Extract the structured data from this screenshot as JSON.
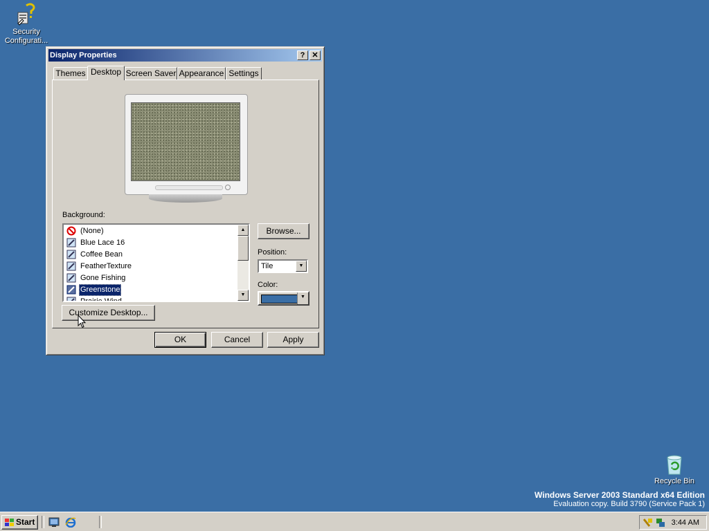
{
  "desktop": {
    "icons": [
      {
        "label": "Security Configurati...",
        "icon": "security-config-icon"
      },
      {
        "label": "Recycle Bin",
        "icon": "recycle-bin-icon"
      }
    ],
    "watermark": {
      "line1": "Windows Server 2003 Standard x64 Edition",
      "line2": "Evaluation copy. Build 3790 (Service Pack 1)"
    },
    "background_color": "#3a6ea5"
  },
  "window": {
    "title": "Display Properties",
    "help_glyph": "?",
    "close_glyph": "✕",
    "tabs": [
      {
        "label": "Themes",
        "active": false
      },
      {
        "label": "Desktop",
        "active": true
      },
      {
        "label": "Screen Saver",
        "active": false
      },
      {
        "label": "Appearance",
        "active": false
      },
      {
        "label": "Settings",
        "active": false
      }
    ],
    "background_label": "Background:",
    "background_items": [
      {
        "label": "(None)",
        "icon": "none-icon"
      },
      {
        "label": "Blue Lace 16",
        "icon": "image-file-icon"
      },
      {
        "label": "Coffee Bean",
        "icon": "image-file-icon"
      },
      {
        "label": "FeatherTexture",
        "icon": "image-file-icon"
      },
      {
        "label": "Gone Fishing",
        "icon": "image-file-icon"
      },
      {
        "label": "Greenstone",
        "icon": "image-file-icon",
        "selected": true
      },
      {
        "label": "Prairie Wind",
        "icon": "image-file-icon"
      }
    ],
    "browse_label": "Browse...",
    "position_label": "Position:",
    "position_value": "Tile",
    "color_label": "Color:",
    "color_value": "#3a6ea5",
    "customize_label": "Customize Desktop...",
    "ok_label": "OK",
    "cancel_label": "Cancel",
    "apply_label": "Apply"
  },
  "taskbar": {
    "start_label": "Start",
    "quick_launch": [
      "desktop-icon",
      "internet-explorer-icon"
    ],
    "clock": "3:44 AM"
  }
}
